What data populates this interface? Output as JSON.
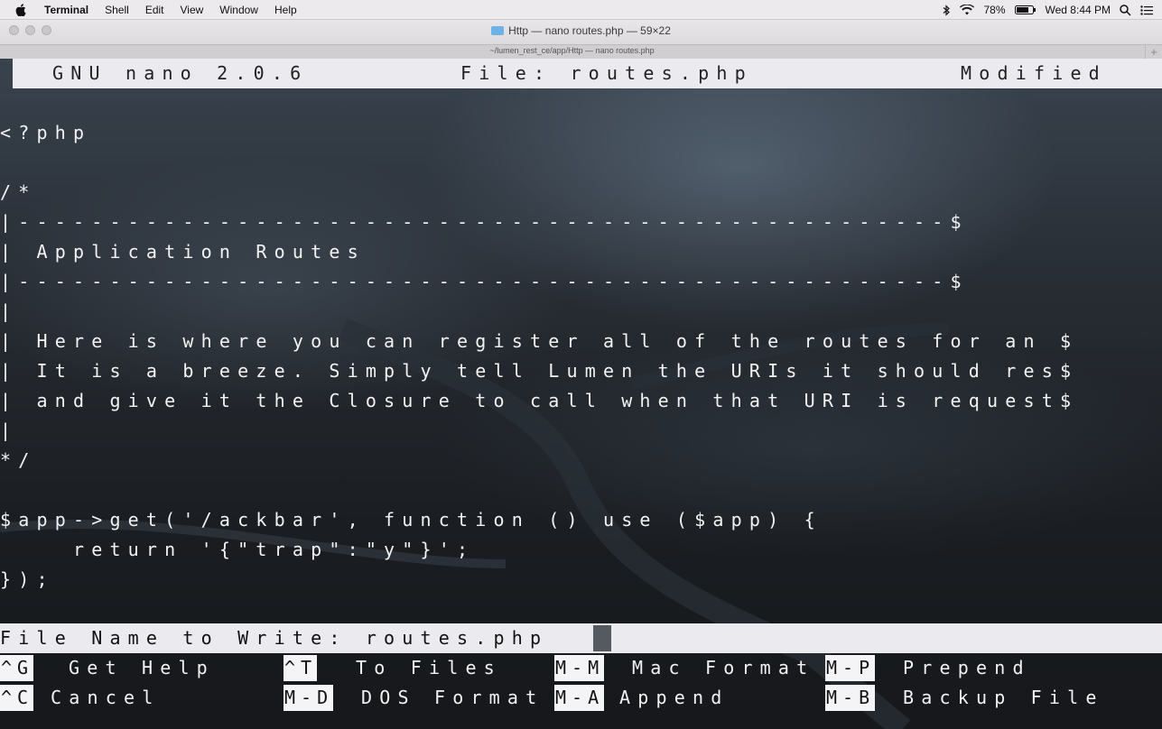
{
  "menubar": {
    "app_name": "Terminal",
    "items": [
      "Shell",
      "Edit",
      "View",
      "Window",
      "Help"
    ],
    "battery": "78%",
    "clock": "Wed 8:44 PM"
  },
  "window": {
    "title": "Http — nano routes.php — 59×22",
    "tab_title": "~/lumen_rest_ce/app/Http — nano routes.php"
  },
  "nano": {
    "version": "GNU nano 2.0.6",
    "file_label": "File: routes.php",
    "status": "Modified",
    "lines": [
      "<?php",
      "",
      "/*",
      "|---------------------------------------------------$",
      "| Application Routes",
      "|---------------------------------------------------$",
      "|",
      "| Here is where you can register all of the routes for an $",
      "| It is a breeze. Simply tell Lumen the URIs it should res$",
      "| and give it the Closure to call when that URI is request$",
      "|",
      "*/",
      "",
      "$app->get('/ackbar', function () use ($app) {",
      "    return '{\"trap\":\"y\"}';",
      "});"
    ],
    "prompt": "File Name to Write: routes.php",
    "shortcuts_row1": [
      {
        "key": "^G",
        "label": "Get Help"
      },
      {
        "key": "^T",
        "label": "To Files"
      },
      {
        "key": "M-M",
        "label": "Mac Format"
      },
      {
        "key": "M-P",
        "label": "Prepend"
      }
    ],
    "shortcuts_row2": [
      {
        "key": "^C",
        "label": "Cancel"
      },
      {
        "key": "M-D",
        "label": "DOS Format"
      },
      {
        "key": "M-A",
        "label": "Append"
      },
      {
        "key": "M-B",
        "label": "Backup File"
      }
    ]
  }
}
